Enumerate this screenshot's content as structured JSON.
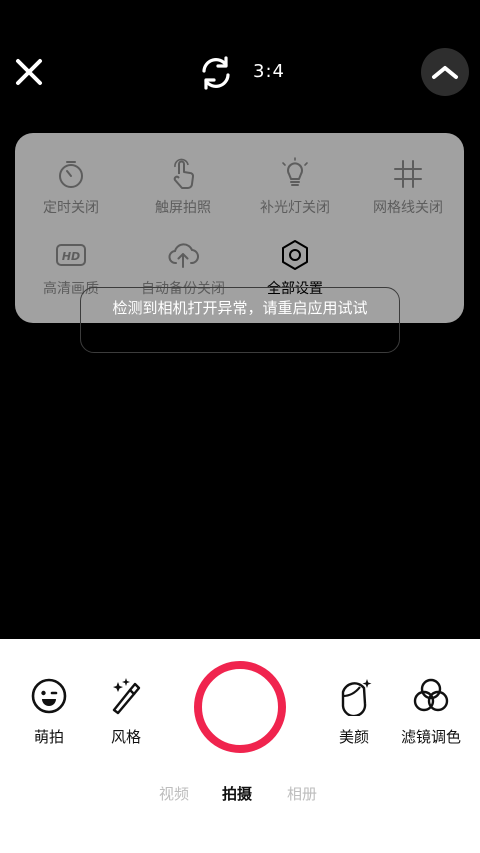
{
  "topbar": {
    "close_icon": "close-icon",
    "rotate_icon": "camera-switch-icon",
    "aspect_ratio": "3:4",
    "collapse_icon": "chevron-up-icon"
  },
  "settings": {
    "items": [
      {
        "label": "定时关闭",
        "icon": "timer-icon",
        "active": false
      },
      {
        "label": "触屏拍照",
        "icon": "touch-icon",
        "active": false
      },
      {
        "label": "补光灯关闭",
        "icon": "bulb-icon",
        "active": false
      },
      {
        "label": "网格线关闭",
        "icon": "grid-icon",
        "active": false
      },
      {
        "label": "高清画质",
        "icon": "hd-icon",
        "active": false
      },
      {
        "label": "自动备份关闭",
        "icon": "cloud-upload-icon",
        "active": false
      },
      {
        "label": "全部设置",
        "icon": "settings-hexagon-icon",
        "active": true
      }
    ]
  },
  "toast": {
    "message": "检测到相机打开异常，请重启应用试试"
  },
  "bottom": {
    "tools": [
      {
        "label": "萌拍",
        "icon": "smile-icon"
      },
      {
        "label": "风格",
        "icon": "magic-wand-icon"
      },
      {
        "label": "美颜",
        "icon": "beauty-face-icon"
      },
      {
        "label": "滤镜调色",
        "icon": "filter-circles-icon"
      }
    ],
    "modes": [
      {
        "label": "视频",
        "active": false
      },
      {
        "label": "拍摄",
        "active": true
      },
      {
        "label": "相册",
        "active": false
      }
    ],
    "shutter_color": "#f0244e"
  }
}
